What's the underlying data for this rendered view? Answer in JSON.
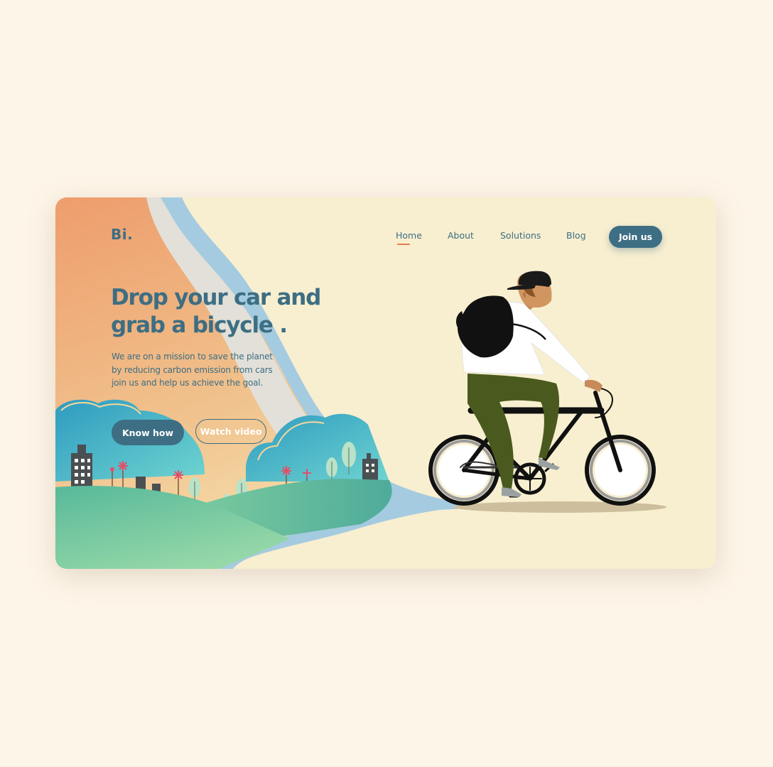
{
  "brand": {
    "logo": "Bi."
  },
  "nav": {
    "items": [
      {
        "label": "Home",
        "active": true
      },
      {
        "label": "About"
      },
      {
        "label": "Solutions"
      },
      {
        "label": "Blog"
      }
    ],
    "cta": "Join us"
  },
  "hero": {
    "headline_lines": [
      "Drop your car and",
      "grab a bicycle ."
    ],
    "description_lines": [
      "We are on a mission to save the planet",
      "by reducing carbon emission from cars",
      "join us and help us achieve the goal."
    ],
    "primary_button": "Know how",
    "secondary_button": "Watch video"
  },
  "colors": {
    "page_background": "#fdf5e8",
    "card_background": "#f8efd0",
    "brand_teal": "#3d6e83",
    "accent_orange": "#e77c4c",
    "river_blue": "#a5cbe0",
    "hill_green": "#78c4a0"
  }
}
